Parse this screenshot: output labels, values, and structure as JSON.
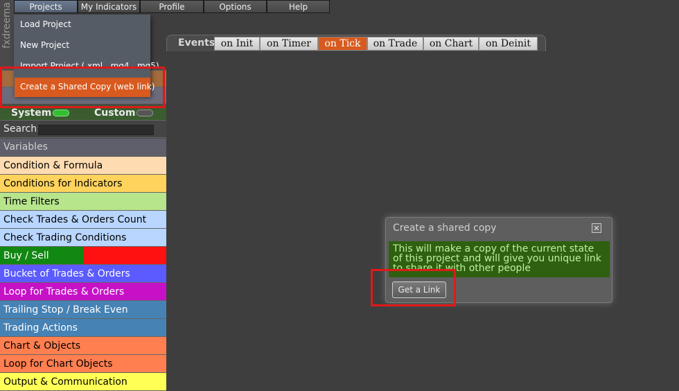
{
  "menubar": {
    "items": [
      {
        "label": "Projects"
      },
      {
        "label": "My Indicators"
      },
      {
        "label": "Profile"
      },
      {
        "label": "Options"
      },
      {
        "label": "Help"
      }
    ]
  },
  "brand": {
    "text": "fxdreema"
  },
  "projects_menu": {
    "items": [
      {
        "label": "Load Project"
      },
      {
        "label": "New Project"
      },
      {
        "label": "Import Project (.xml, .mq4, .mq5)"
      },
      {
        "label": "Create a Shared Copy (web link)"
      }
    ]
  },
  "sidebar": {
    "toggles": {
      "system": "System",
      "custom": "Custom"
    },
    "search_label": "Search:",
    "variables_label": "Variables",
    "categories": [
      {
        "label": "Condition & Formula",
        "color": "#ffdbb1"
      },
      {
        "label": "Conditions for Indicators",
        "color": "#ffd35c"
      },
      {
        "label": "Time Filters",
        "color": "#b7e58c"
      },
      {
        "label": "Check Trades & Orders Count",
        "color": "#b8d6ff"
      },
      {
        "label": "Check Trading Conditions",
        "color": "#b8d6ff"
      },
      {
        "label": "Buy / Sell",
        "color": "#118811"
      },
      {
        "label": "Bucket of Trades & Orders",
        "color": "#5b5bff"
      },
      {
        "label": "Loop for Trades & Orders",
        "color": "#c711c7"
      },
      {
        "label": "Trailing Stop / Break Even",
        "color": "#4682b4"
      },
      {
        "label": "Trading Actions",
        "color": "#4682b4"
      },
      {
        "label": "Chart & Objects",
        "color": "#ff7f50"
      },
      {
        "label": "Loop for Chart Objects",
        "color": "#ff7f50"
      },
      {
        "label": "Output & Communication",
        "color": "#ffff55"
      }
    ]
  },
  "tabs": {
    "label": "Events",
    "items": [
      {
        "label": "on Init"
      },
      {
        "label": "on Timer"
      },
      {
        "label": "on Tick",
        "active": true
      },
      {
        "label": "on Trade"
      },
      {
        "label": "on Chart"
      },
      {
        "label": "on Deinit"
      }
    ]
  },
  "dialog": {
    "title": "Create a shared copy",
    "message": "This will make a copy of the current state of this project and will give you unique link to share it with other people",
    "button": "Get a Link"
  },
  "colors": {
    "accent": "#d85a1e",
    "highlight_box": "#e01919",
    "message_bg": "#2f6010"
  }
}
